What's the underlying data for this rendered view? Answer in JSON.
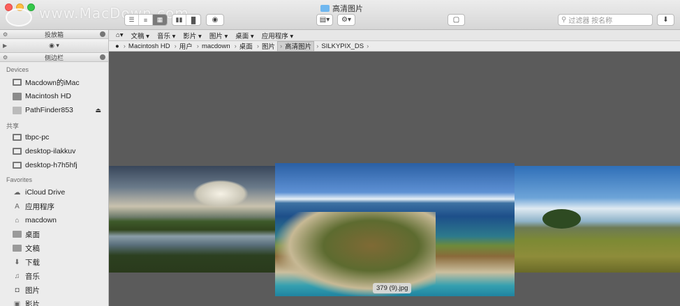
{
  "window": {
    "title": "高清图片",
    "watermark": "www.MacDown.com"
  },
  "toolbar": {
    "view_seg": [
      "☰",
      "≡",
      "▦"
    ],
    "view_seg2": [
      "▮▮",
      "▐▌"
    ],
    "eye": "◉",
    "search_placeholder": "过滤器 按名称"
  },
  "sidebar": {
    "panel1": "投放箱",
    "panel2": "侧边栏",
    "sections": {
      "devices": "Devices",
      "shared": "共享",
      "favorites": "Favorites"
    },
    "devices": [
      "Macdown的iMac",
      "Macintosh HD",
      "PathFinder853"
    ],
    "shared": [
      "tbpc-pc",
      "desktop-ilakkuv",
      "desktop-h7h5hfj"
    ],
    "favorites": [
      "iCloud Drive",
      "应用程序",
      "macdown",
      "桌面",
      "文稿",
      "下载",
      "音乐",
      "图片",
      "影片"
    ]
  },
  "navbar": {
    "items": [
      "文稿",
      "音乐",
      "影片",
      "图片",
      "桌面",
      "应用程序"
    ]
  },
  "breadcrumb": [
    "Macintosh HD",
    "用户",
    "macdown",
    "桌面",
    "图片",
    "高清图片",
    "SILKYPIX_DS"
  ],
  "coverflow": {
    "caption": "379 (9).jpg"
  }
}
